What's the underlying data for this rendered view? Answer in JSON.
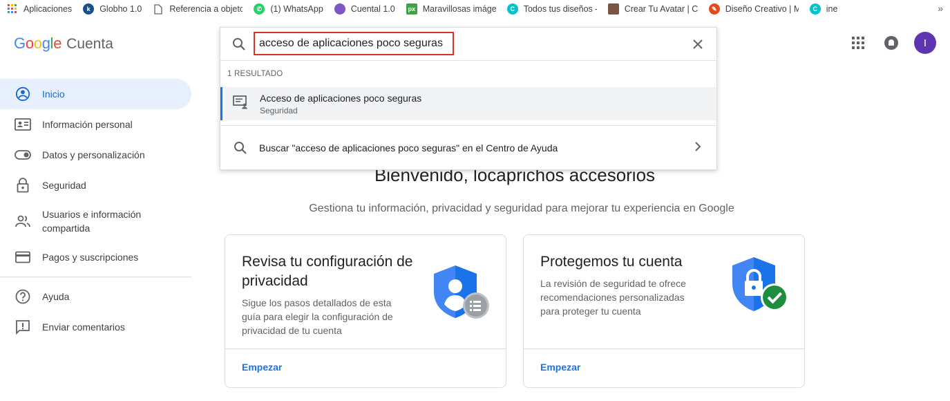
{
  "bookmarks": [
    {
      "label": "Aplicaciones",
      "icon": "apps-grid-icon",
      "color": "#ea4335"
    },
    {
      "label": "Globho 1.0",
      "icon": "globho-icon",
      "color": "#1a4f8b"
    },
    {
      "label": "Referencia a objeto n",
      "icon": "page-icon",
      "color": "#9aa0a6"
    },
    {
      "label": "(1) WhatsApp",
      "icon": "whatsapp-icon",
      "color": "#25d366"
    },
    {
      "label": "Cuental 1.0",
      "icon": "cuental-icon",
      "color": "#7e57c2"
    },
    {
      "label": "Maravillosas imágene",
      "icon": "px-icon",
      "color": "#43a047"
    },
    {
      "label": "Todos tus diseños – C",
      "icon": "canva-icon",
      "color": "#00c4cc"
    },
    {
      "label": "Crear Tu Avatar | Cre",
      "icon": "avatar-site-icon",
      "color": "#795548"
    },
    {
      "label": "Diseño Creativo | Ma",
      "icon": "creative-icon",
      "color": "#e64a19"
    },
    {
      "label": "ine",
      "icon": "canva-icon",
      "color": "#00c4cc"
    }
  ],
  "bookmarks_more": "»",
  "header": {
    "logo": "Google",
    "product": "Cuenta",
    "avatar_initial": "I"
  },
  "sidebar": {
    "items": [
      {
        "label": "Inicio",
        "icon": "account-circle-icon",
        "active": true
      },
      {
        "label": "Información personal",
        "icon": "id-card-icon"
      },
      {
        "label": "Datos y personalización",
        "icon": "toggle-icon"
      },
      {
        "label": "Seguridad",
        "icon": "lock-icon"
      },
      {
        "label": "Usuarios e información compartida",
        "icon": "people-icon"
      },
      {
        "label": "Pagos y suscripciones",
        "icon": "credit-card-icon"
      }
    ],
    "secondary": [
      {
        "label": "Ayuda",
        "icon": "help-icon"
      },
      {
        "label": "Enviar comentarios",
        "icon": "feedback-icon"
      }
    ]
  },
  "search": {
    "value": "acceso de aplicaciones poco seguras",
    "result_count": "1 RESULTADO",
    "result": {
      "title": "Acceso de aplicaciones poco seguras",
      "subtitle": "Seguridad"
    },
    "help_text": "Buscar \"acceso de aplicaciones poco seguras\" en el Centro de Ayuda"
  },
  "main": {
    "welcome": "Bienvenido, locaprichos accesorios",
    "subtitle": "Gestiona tu información, privacidad y seguridad para mejorar tu experiencia en Google"
  },
  "cards": [
    {
      "title": "Revisa tu configuración de privacidad",
      "description": "Sigue los pasos detallados de esta guía para elegir la configuración de privacidad de tu cuenta",
      "link": "Empezar"
    },
    {
      "title": "Protegemos tu cuenta",
      "description": "La revisión de seguridad te ofrece recomendaciones personalizadas para proteger tu cuenta",
      "link": "Empezar"
    }
  ],
  "colors": {
    "blue": "#1a73e8",
    "red": "#d93025",
    "green": "#1e8e3e",
    "active_bg": "#e8f0fe",
    "avatar": "#5e35b1"
  }
}
